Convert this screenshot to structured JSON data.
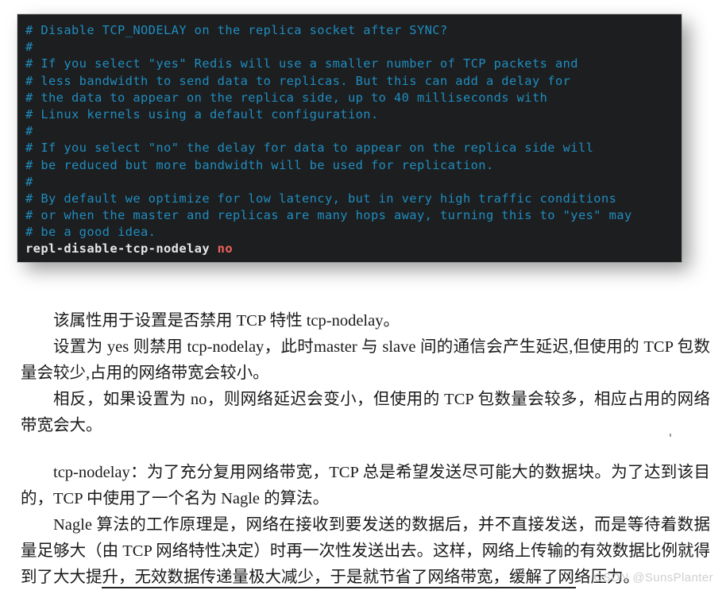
{
  "terminal": {
    "background_color": "#1d1e1f",
    "comment_color": "#1f8dc0",
    "directive_color": "#e8e8e8",
    "value_color": "#f0635f",
    "lines": [
      {
        "kind": "comment",
        "text": "# Disable TCP_NODELAY on the replica socket after SYNC?"
      },
      {
        "kind": "comment",
        "text": "#"
      },
      {
        "kind": "comment",
        "text": "# If you select \"yes\" Redis will use a smaller number of TCP packets and"
      },
      {
        "kind": "comment",
        "text": "# less bandwidth to send data to replicas. But this can add a delay for"
      },
      {
        "kind": "comment",
        "text": "# the data to appear on the replica side, up to 40 milliseconds with"
      },
      {
        "kind": "comment",
        "text": "# Linux kernels using a default configuration."
      },
      {
        "kind": "comment",
        "text": "#"
      },
      {
        "kind": "comment",
        "text": "# If you select \"no\" the delay for data to appear on the replica side will"
      },
      {
        "kind": "comment",
        "text": "# be reduced but more bandwidth will be used for replication."
      },
      {
        "kind": "comment",
        "text": "#"
      },
      {
        "kind": "comment",
        "text": "# By default we optimize for low latency, but in very high traffic conditions"
      },
      {
        "kind": "comment",
        "text": "# or when the master and replicas are many hops away, turning this to \"yes\" may"
      },
      {
        "kind": "comment",
        "text": "# be a good idea."
      },
      {
        "kind": "directive",
        "key": "repl-disable-tcp-nodelay",
        "value": "no"
      }
    ]
  },
  "prose": {
    "paragraphs": [
      "该属性用于设置是否禁用 TCP 特性 tcp-nodelay。",
      "设置为 yes 则禁用 tcp-nodelay，此时master 与 slave 间的通信会产生延迟,但使用的 TCP 包数量会较少,占用的网络带宽会较小。",
      "相反，如果设置为 no，则网络延迟会变小，但使用的 TCP 包数量会较多，相应占用的网络带宽会大。",
      "tcp-nodelay：为了充分复用网络带宽，TCP 总是希望发送尽可能大的数据块。为了达到该目的，TCP 中使用了一个名为 Nagle 的算法。",
      "Nagle 算法的工作原理是，网络在接收到要发送的数据后，并不直接发送，而是等待着数据量足够大（由 TCP 网络特性决定）时再一次性发送出去。这样，网络上传输的有效数据比例就得到了大大提升，无效数据传递量极大减少，于是就节省了网络带宽，缓解了网络压力。"
    ]
  },
  "watermark": {
    "text": "CSDN @SunsPlanter",
    "color": "#cfcfcf"
  }
}
